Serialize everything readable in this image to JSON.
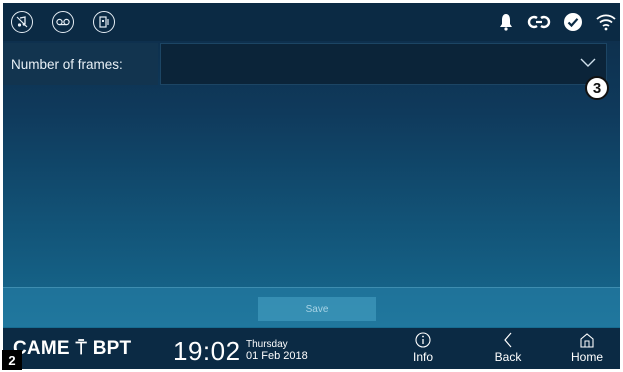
{
  "topbar": {
    "left_icons": [
      {
        "name": "music-mute-icon"
      },
      {
        "name": "voicemail-icon"
      },
      {
        "name": "door-icon"
      }
    ],
    "status_icons": [
      {
        "name": "bell-icon"
      },
      {
        "name": "link-icon"
      },
      {
        "name": "checkmark-icon"
      },
      {
        "name": "wifi-icon"
      }
    ]
  },
  "form": {
    "label": "Number of frames:",
    "value": ""
  },
  "callout": "3",
  "savebar": {
    "save_label": "Save"
  },
  "bottombar": {
    "brand_left": "CAME",
    "brand_right": "BPT",
    "time": "19:02",
    "day": "Thursday",
    "date": "01 Feb 2018",
    "nav": {
      "info_label": "Info",
      "back_label": "Back",
      "home_label": "Home"
    }
  },
  "figure_tag": "2",
  "colors": {
    "bar_background": "#0b2a44",
    "gradient_top": "#0d2b46",
    "gradient_bottom": "#19749a",
    "text": "#ffffff"
  }
}
